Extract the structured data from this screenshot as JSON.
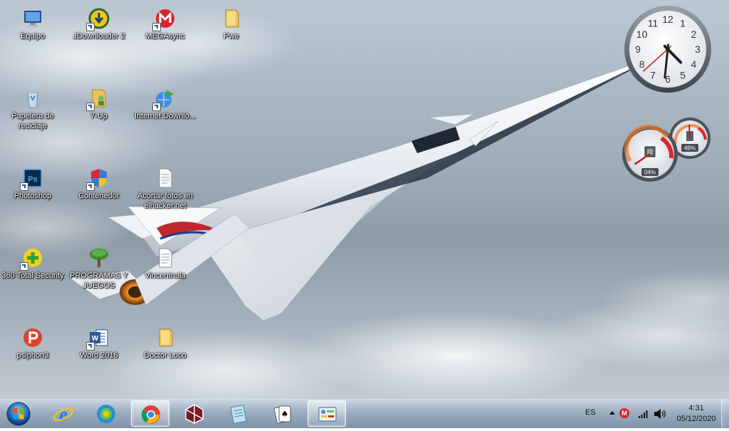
{
  "desktop": {
    "icons": [
      {
        "label": "Equipo",
        "icon": "computer-icon"
      },
      {
        "label": "JDownloader 2",
        "icon": "jdownloader-icon"
      },
      {
        "label": "MEGAsync",
        "icon": "mega-icon"
      },
      {
        "label": "Pwe",
        "icon": "folder-icon"
      },
      {
        "label": "Papelera de reciclaje",
        "icon": "recycle-bin-icon"
      },
      {
        "label": "7-Up",
        "icon": "user-folder-icon"
      },
      {
        "label": "Internet Downlo...",
        "icon": "idm-icon"
      },
      {
        "label": "Photoshop",
        "icon": "photoshop-icon"
      },
      {
        "label": "Contenedor",
        "icon": "shield-icon"
      },
      {
        "label": "Acortar fotos en elhacker.net",
        "icon": "text-file-icon"
      },
      {
        "label": "360 Total Security",
        "icon": "security-icon"
      },
      {
        "label": "PROGRAMAS Y JUEGOS",
        "icon": "tree-icon"
      },
      {
        "label": "Vincentnala",
        "icon": "text-file-icon"
      },
      {
        "label": "psiphon3",
        "icon": "psiphon-icon"
      },
      {
        "label": "Word 2016",
        "icon": "word-icon"
      },
      {
        "label": "Doctor Loco",
        "icon": "folder-icon"
      }
    ]
  },
  "gadgets": {
    "clock": {
      "numbers": [
        "12",
        "1",
        "2",
        "3",
        "4",
        "5",
        "6",
        "7",
        "8",
        "9",
        "10",
        "11"
      ],
      "hour": 4.52,
      "minute": 31,
      "second": 38
    },
    "meter": {
      "cpu_label": "04%",
      "memory_label": "49%",
      "cpu_percent": 4,
      "memory_percent": 49
    }
  },
  "taskbar": {
    "start_label": "Start",
    "buttons": [
      {
        "name": "internet-explorer",
        "icon": "ie-icon",
        "active": false
      },
      {
        "name": "media-app",
        "icon": "media-player-icon",
        "active": false
      },
      {
        "name": "chrome",
        "icon": "chrome-icon",
        "active": true
      },
      {
        "name": "app-red-cube",
        "icon": "cube-icon",
        "active": false
      },
      {
        "name": "notepad",
        "icon": "notepad-icon",
        "active": false
      },
      {
        "name": "solitaire",
        "icon": "cards-icon",
        "active": false
      },
      {
        "name": "control-panel",
        "icon": "control-panel-icon",
        "active": true
      }
    ],
    "tray": {
      "language": "ES",
      "time": "4:31",
      "date": "05/12/2020"
    }
  },
  "colors": {
    "mega_red": "#d9272e",
    "taskbar_top": "#c8d4e1",
    "taskbar_bottom": "#788ca2"
  }
}
